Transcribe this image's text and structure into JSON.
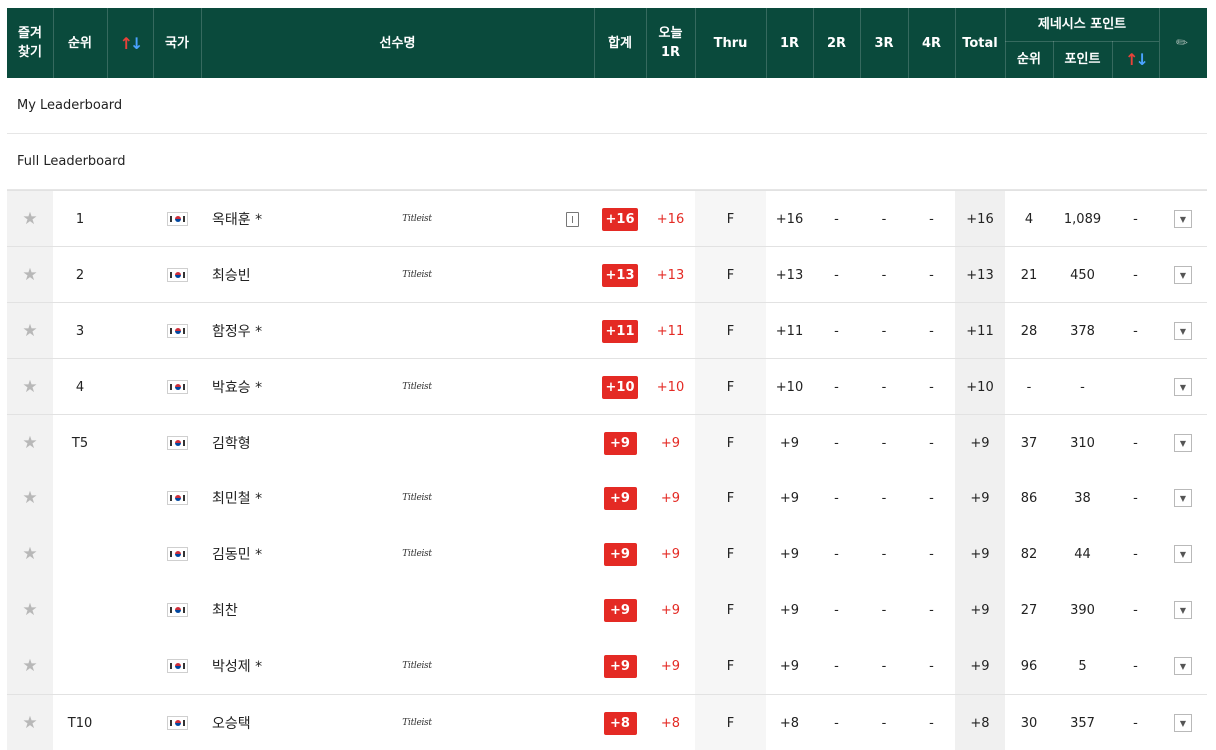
{
  "header": {
    "fav": "즐겨\n찾기",
    "rank": "순위",
    "sort_icon": "sort-arrows-icon",
    "country": "국가",
    "player": "선수명",
    "sum": "합계",
    "today": "오늘\n1R",
    "thru": "Thru",
    "r1": "1R",
    "r2": "2R",
    "r3": "3R",
    "r4": "4R",
    "total": "Total",
    "genesis_title": "제네시스 포인트",
    "genesis_rank": "순위",
    "genesis_point": "포인트",
    "pin_icon": "pin-icon"
  },
  "sections": {
    "my": "My Leaderboard",
    "full": "Full Leaderboard"
  },
  "colors": {
    "header_bg": "#0a4a3c",
    "badge": "#e42a24",
    "sort_up": "#e8423a",
    "sort_down": "#4aa3ff"
  },
  "rows": [
    {
      "rank": "1",
      "name": "옥태훈 *",
      "brand": "Titleist",
      "book": true,
      "sum": "+16",
      "today": "+16",
      "thru": "F",
      "r1": "+16",
      "r2": "-",
      "r3": "-",
      "r4": "-",
      "total": "+16",
      "g_rank": "4",
      "g_point": "1,089",
      "g_move": "-",
      "group_start": true
    },
    {
      "rank": "2",
      "name": "최승빈",
      "brand": "Titleist",
      "book": false,
      "sum": "+13",
      "today": "+13",
      "thru": "F",
      "r1": "+13",
      "r2": "-",
      "r3": "-",
      "r4": "-",
      "total": "+13",
      "g_rank": "21",
      "g_point": "450",
      "g_move": "-",
      "group_start": true
    },
    {
      "rank": "3",
      "name": "함정우 *",
      "brand": "",
      "book": false,
      "sum": "+11",
      "today": "+11",
      "thru": "F",
      "r1": "+11",
      "r2": "-",
      "r3": "-",
      "r4": "-",
      "total": "+11",
      "g_rank": "28",
      "g_point": "378",
      "g_move": "-",
      "group_start": true
    },
    {
      "rank": "4",
      "name": "박효승 *",
      "brand": "Titleist",
      "book": false,
      "sum": "+10",
      "today": "+10",
      "thru": "F",
      "r1": "+10",
      "r2": "-",
      "r3": "-",
      "r4": "-",
      "total": "+10",
      "g_rank": "-",
      "g_point": "-",
      "g_move": "",
      "group_start": true
    },
    {
      "rank": "T5",
      "name": "김학형",
      "brand": "",
      "book": false,
      "sum": "+9",
      "today": "+9",
      "thru": "F",
      "r1": "+9",
      "r2": "-",
      "r3": "-",
      "r4": "-",
      "total": "+9",
      "g_rank": "37",
      "g_point": "310",
      "g_move": "-",
      "group_start": true
    },
    {
      "rank": "",
      "name": "최민철 *",
      "brand": "Titleist",
      "book": false,
      "sum": "+9",
      "today": "+9",
      "thru": "F",
      "r1": "+9",
      "r2": "-",
      "r3": "-",
      "r4": "-",
      "total": "+9",
      "g_rank": "86",
      "g_point": "38",
      "g_move": "-",
      "group_start": false
    },
    {
      "rank": "",
      "name": "김동민 *",
      "brand": "Titleist",
      "book": false,
      "sum": "+9",
      "today": "+9",
      "thru": "F",
      "r1": "+9",
      "r2": "-",
      "r3": "-",
      "r4": "-",
      "total": "+9",
      "g_rank": "82",
      "g_point": "44",
      "g_move": "-",
      "group_start": false
    },
    {
      "rank": "",
      "name": "최찬",
      "brand": "",
      "book": false,
      "sum": "+9",
      "today": "+9",
      "thru": "F",
      "r1": "+9",
      "r2": "-",
      "r3": "-",
      "r4": "-",
      "total": "+9",
      "g_rank": "27",
      "g_point": "390",
      "g_move": "-",
      "group_start": false
    },
    {
      "rank": "",
      "name": "박성제 *",
      "brand": "Titleist",
      "book": false,
      "sum": "+9",
      "today": "+9",
      "thru": "F",
      "r1": "+9",
      "r2": "-",
      "r3": "-",
      "r4": "-",
      "total": "+9",
      "g_rank": "96",
      "g_point": "5",
      "g_move": "-",
      "group_start": false
    },
    {
      "rank": "T10",
      "name": "오승택",
      "brand": "Titleist",
      "book": false,
      "sum": "+8",
      "today": "+8",
      "thru": "F",
      "r1": "+8",
      "r2": "-",
      "r3": "-",
      "r4": "-",
      "total": "+8",
      "g_rank": "30",
      "g_point": "357",
      "g_move": "-",
      "group_start": true
    }
  ]
}
